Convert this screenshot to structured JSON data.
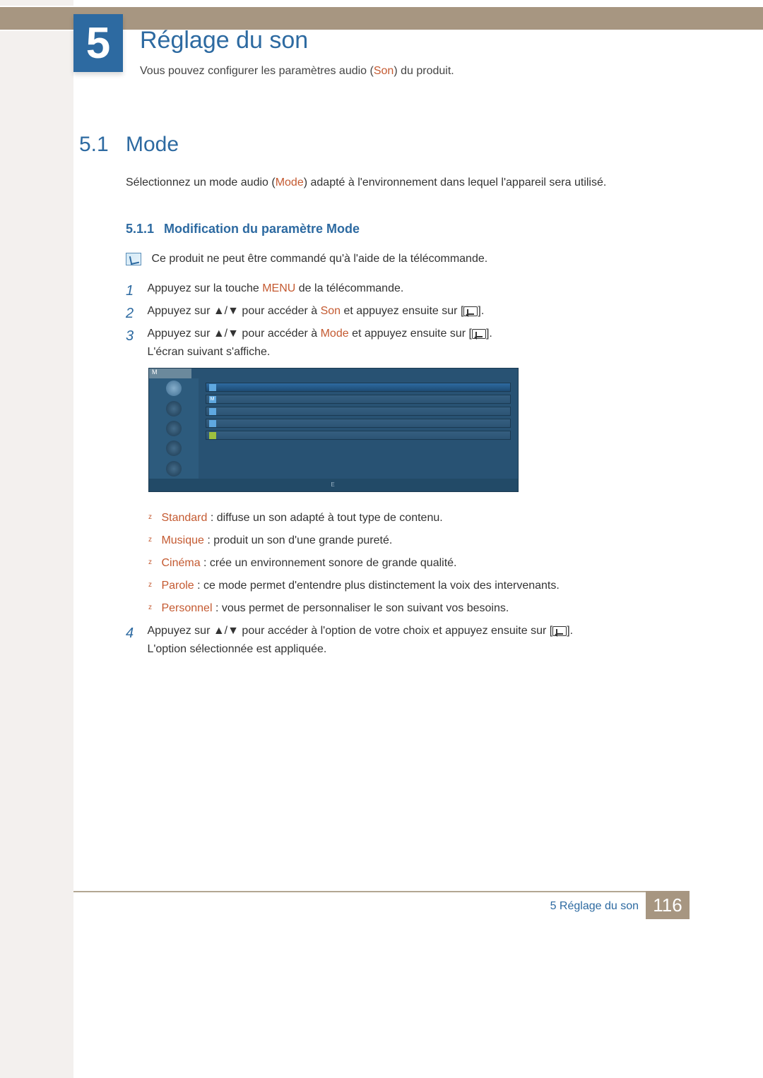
{
  "chapter": {
    "number": "5",
    "title": "Réglage du son"
  },
  "intro": {
    "pre": "Vous pouvez configurer les paramètres audio (",
    "kw": "Son",
    "post": ") du produit."
  },
  "section": {
    "num": "5.1",
    "title": "Mode",
    "intro_pre": "Sélectionnez un mode audio (",
    "intro_kw": "Mode",
    "intro_post": ") adapté à l'environnement dans lequel l'appareil sera utilisé."
  },
  "subsection": {
    "num": "5.1.1",
    "title": "Modification du paramètre Mode"
  },
  "note": "Ce produit ne peut être commandé qu'à l'aide de la télécommande.",
  "steps": {
    "s1_pre": "Appuyez sur la touche ",
    "s1_kw": "MENU",
    "s1_post": " de la télécommande.",
    "s2_pre": "Appuyez sur ",
    "s2_arrows": "▲/▼",
    "s2_mid": " pour accéder à ",
    "s2_kw": "Son",
    "s2_post": " et appuyez ensuite sur [",
    "s2_close": "].",
    "s3_pre": "Appuyez sur ",
    "s3_arrows": "▲/▼",
    "s3_mid": " pour accéder à ",
    "s3_kw": "Mode",
    "s3_post": " et appuyez ensuite sur [",
    "s3_close": "].",
    "s3_line2": "L'écran suivant s'affiche.",
    "s4_pre": "Appuyez sur ",
    "s4_arrows": "▲/▼",
    "s4_mid": " pour accéder à l'option de votre choix et appuyez ensuite sur [",
    "s4_close": "].",
    "s4_line2": "L'option sélectionnée est appliquée."
  },
  "bullets": [
    {
      "kw": "Standard",
      "txt": " : diffuse un son adapté à tout type de contenu."
    },
    {
      "kw": "Musique",
      "txt": " : produit un son d'une grande pureté."
    },
    {
      "kw": "Cinéma",
      "txt": " : crée un environnement sonore de grande qualité."
    },
    {
      "kw": "Parole",
      "txt": " : ce mode permet d'entendre plus distinctement la voix des intervenants."
    },
    {
      "kw": "Personnel",
      "txt": " : vous permet de personnaliser le son suivant vos besoins."
    }
  ],
  "osd": {
    "header": "M",
    "rows": [
      "",
      "M",
      "",
      "",
      ""
    ],
    "footer": "E"
  },
  "footer": {
    "chapter": "5 Réglage du son",
    "page": "116"
  }
}
